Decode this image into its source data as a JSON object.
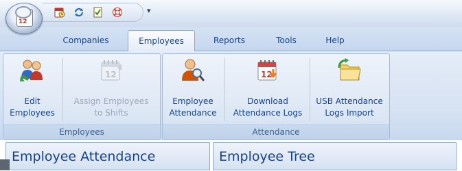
{
  "quick_access": {
    "buttons": [
      {
        "icon": "calendar-clock-icon",
        "color": "#c0392b"
      },
      {
        "icon": "refresh-icon",
        "color": "#2b6cb0"
      },
      {
        "icon": "checklist-icon",
        "color": "#4a7a25"
      },
      {
        "icon": "lifebuoy-icon",
        "color": "#d64541"
      }
    ],
    "customize_glyph": "▾"
  },
  "app_button": {
    "icon": "time-clock-app-icon",
    "badge": "12"
  },
  "tabs": [
    {
      "label": "Companies",
      "active": false
    },
    {
      "label": "Employees",
      "active": true
    },
    {
      "label": "Reports",
      "active": false
    },
    {
      "label": "Tools",
      "active": false
    },
    {
      "label": "Help",
      "active": false
    }
  ],
  "ribbon": {
    "groups": [
      {
        "label": "Employees",
        "buttons": [
          {
            "label": "Edit\nEmployees",
            "icon": "edit-employees-icon",
            "enabled": true
          },
          {
            "label": "Assign Employees\nto Shifts",
            "icon": "assign-shifts-calendar-icon",
            "enabled": false
          }
        ]
      },
      {
        "label": "Attendance",
        "buttons": [
          {
            "label": "Employee\nAttendance",
            "icon": "employee-search-icon",
            "enabled": true
          },
          {
            "label": "Download\nAttendance Logs",
            "icon": "download-logs-calendar-icon",
            "enabled": true
          },
          {
            "label": "USB Attendance\nLogs Import",
            "icon": "usb-import-folder-icon",
            "enabled": true
          }
        ]
      }
    ]
  },
  "panels": [
    {
      "title": "Employee Attendance"
    },
    {
      "title": "Employee Tree"
    }
  ],
  "colors": {
    "accent_text": "#15428b",
    "ribbon_bg": "#dbe6f4",
    "disabled_text": "#9aa8ba"
  }
}
